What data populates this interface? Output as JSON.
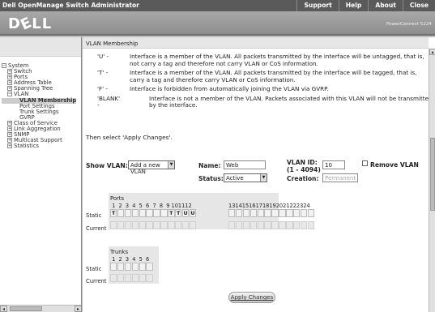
{
  "topbar": {
    "title": "Dell OpenManage Switch Administrator",
    "nav": [
      "Support",
      "Help",
      "About",
      "Close"
    ]
  },
  "header": {
    "logo": "DELL",
    "product": "PowerConnect 5224"
  },
  "tree": [
    {
      "label": "System",
      "box": "−",
      "indent": 0
    },
    {
      "label": "Switch",
      "box": "+",
      "indent": 1
    },
    {
      "label": "Ports",
      "box": "+",
      "indent": 1
    },
    {
      "label": "Address Table",
      "box": "+",
      "indent": 1
    },
    {
      "label": "Spanning Tree",
      "box": "+",
      "indent": 1
    },
    {
      "label": "VLAN",
      "box": "−",
      "indent": 1
    },
    {
      "label": "VLAN Membership",
      "box": "",
      "indent": 2,
      "selected": true
    },
    {
      "label": "Port Settings",
      "box": "",
      "indent": 2
    },
    {
      "label": "Trunk Settings",
      "box": "",
      "indent": 2
    },
    {
      "label": "GVRP",
      "box": "",
      "indent": 2
    },
    {
      "label": "Class of Service",
      "box": "+",
      "indent": 1
    },
    {
      "label": "Link Aggregation",
      "box": "+",
      "indent": 1
    },
    {
      "label": "SNMP",
      "box": "+",
      "indent": 1
    },
    {
      "label": "Multicast Support",
      "box": "+",
      "indent": 1
    },
    {
      "label": "Statistics",
      "box": "+",
      "indent": 1
    }
  ],
  "page": {
    "breadcrumb": "VLAN Membership",
    "legend": [
      {
        "key": "'U' -",
        "text": "Interface is a member of the VLAN. All packets transmitted by the interface will be untagged, that is, not carry a tag and therefore not carry VLAN or CoS information."
      },
      {
        "key": "'T' -",
        "text": "Interface is a member of the VLAN. All packets transmitted by the interface will be tagged, that is, carry a tag and therefore carry VLAN or CoS information."
      },
      {
        "key": "'F' -",
        "text": "Interface is forbidden from automatically joining the VLAN via GVRP."
      },
      {
        "key": "'BLANK' -",
        "text": "Interface is not a member of the VLAN. Packets associated with this VLAN will not be transmitted by the interface."
      }
    ],
    "instruction": "Then select 'Apply Changes'.",
    "form": {
      "show_vlan_label": "Show VLAN:",
      "show_vlan_value": "Add a new VLAN",
      "name_label": "Name:",
      "name_value": "Web",
      "status_label": "Status:",
      "status_value": "Active",
      "vlan_id_label": "VLAN ID:",
      "vlan_id_range": "(1 - 4094)",
      "vlan_id_value": "10",
      "creation_label": "Creation:",
      "creation_placeholder": "Permanent",
      "remove_vlan_label": "Remove VLAN"
    },
    "ports": {
      "title": "Ports",
      "static_label": "Static",
      "current_label": "Current",
      "group1": [
        "1",
        "2",
        "3",
        "4",
        "5",
        "6",
        "7",
        "8",
        "9",
        "10",
        "11",
        "12"
      ],
      "group2": [
        "13",
        "14",
        "15",
        "16",
        "17",
        "18",
        "19",
        "20",
        "21",
        "22",
        "23",
        "24"
      ],
      "static_values": [
        "T",
        "",
        "",
        "",
        "",
        "",
        "",
        "",
        "T",
        "T",
        "U",
        "U",
        "",
        "",
        "",
        "",
        "",
        "",
        "",
        "",
        "",
        "",
        "",
        ""
      ]
    },
    "trunks": {
      "title": "Trunks",
      "static_label": "Static",
      "current_label": "Current",
      "numbers": [
        "1",
        "2",
        "3",
        "4",
        "5",
        "6"
      ]
    },
    "apply_label": "Apply Changes"
  }
}
